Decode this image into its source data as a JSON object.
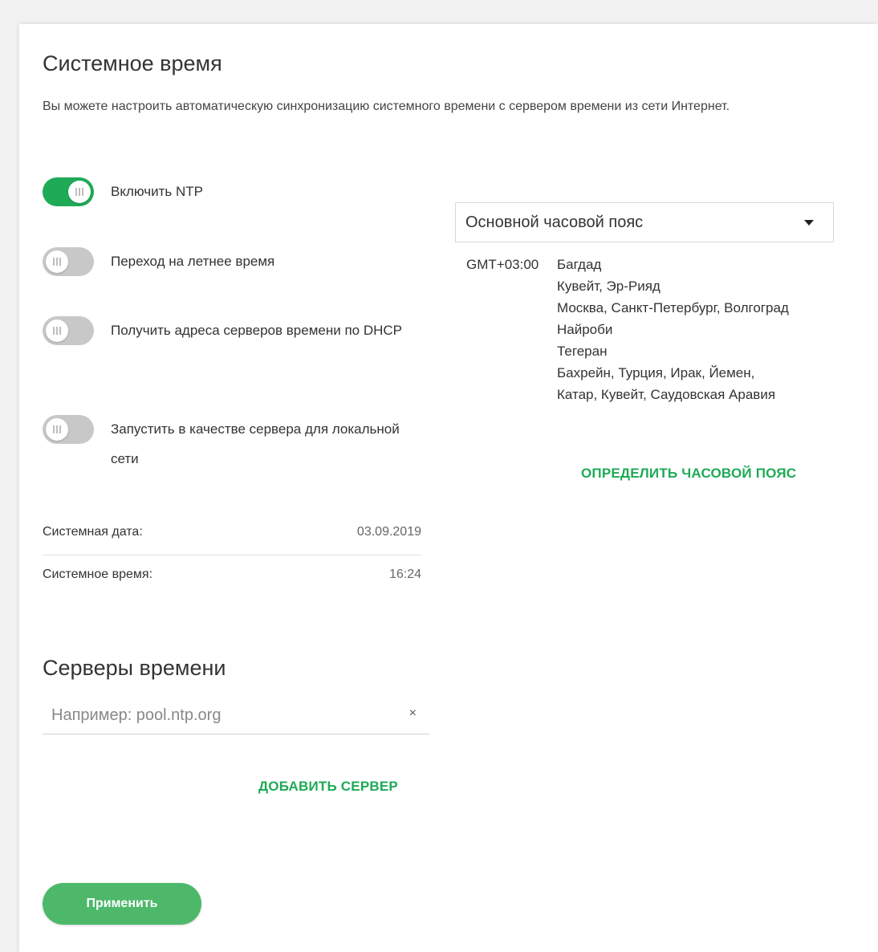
{
  "page": {
    "title": "Системное время",
    "description": "Вы можете настроить автоматическую синхронизацию системного времени с сервером времени из сети Интернет."
  },
  "toggles": [
    {
      "label": "Включить NTP",
      "on": true
    },
    {
      "label": "Переход на летнее время",
      "on": false
    },
    {
      "label": "Получить адреса серверов времени по DHCP",
      "on": false
    },
    {
      "label": "Запустить в качестве сервера для локальной сети",
      "on": false
    }
  ],
  "system_info": {
    "date_label": "Системная дата:",
    "date_value": "03.09.2019",
    "time_label": "Системное время:",
    "time_value": "16:24"
  },
  "servers": {
    "title": "Серверы времени",
    "input_value": "",
    "input_placeholder": "Например: pool.ntp.org",
    "clear_symbol": "×",
    "add_label": "ДОБАВИТЬ СЕРВЕР"
  },
  "timezone": {
    "select_value": "Основной часовой пояс",
    "gmt": "GMT+03:00",
    "cities": [
      "Багдад",
      "Кувейт, Эр-Рияд",
      "Москва, Санкт-Петербург, Волгоград",
      "Найроби",
      "Тегеран",
      "Бахрейн, Турция, Ирак, Йемен,",
      "Катар, Кувейт, Саудовская Аравия"
    ],
    "detect_label": "ОПРЕДЕЛИТЬ ЧАСОВОЙ ПОЯС"
  },
  "actions": {
    "apply_label": "Применить"
  },
  "colors": {
    "accent": "#1eaa57",
    "apply_button": "#4db86a",
    "toggle_off": "#c8c8c8"
  }
}
